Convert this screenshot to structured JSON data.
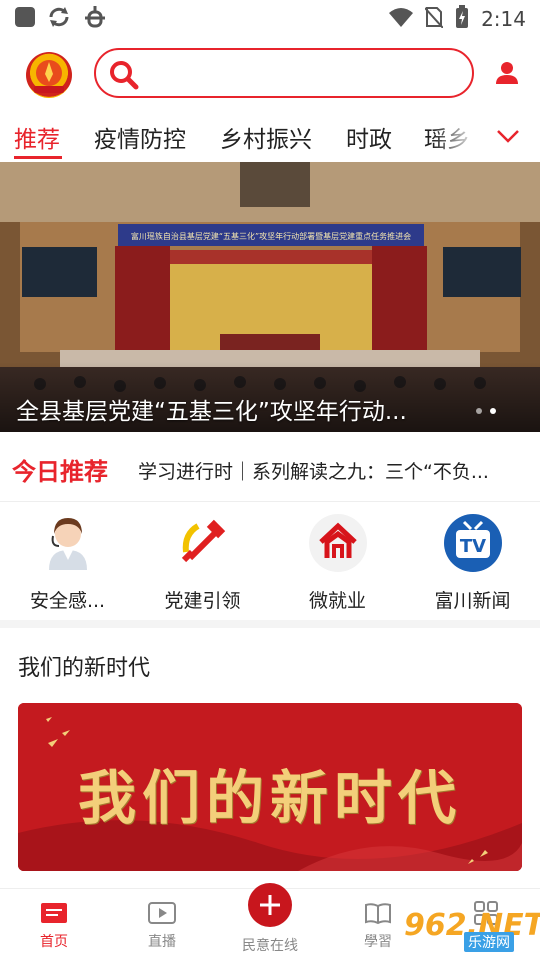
{
  "status_bar": {
    "time": "2:14",
    "icons": [
      "app-square-icon",
      "sync-icon",
      "bug-icon",
      "wifi-icon",
      "no-sim-icon",
      "battery-charging-icon"
    ]
  },
  "header": {
    "logo": "富川融媒",
    "search": {
      "placeholder": ""
    }
  },
  "tabs": [
    {
      "label": "推荐",
      "active": true
    },
    {
      "label": "疫情防控",
      "active": false
    },
    {
      "label": "乡村振兴",
      "active": false
    },
    {
      "label": "时政",
      "active": false
    },
    {
      "label": "瑶乡",
      "active": false
    }
  ],
  "banner": {
    "caption": "全县基层党建“五基三化”攻坚年行动...",
    "hall_banner_text": "富川瑶族自治县基层党建“五基三化”攻坚年行动部署暨基层党建重点任务推进会",
    "dots": [
      false,
      true
    ]
  },
  "today": {
    "title": "今日推荐",
    "text": "学习进行时｜系列解读之九：三个“不负..."
  },
  "quick_links": [
    {
      "label": "安全感...",
      "icon": "customer-service-icon"
    },
    {
      "label": "党建引领",
      "icon": "party-emblem-icon"
    },
    {
      "label": "微就业",
      "icon": "employment-icon"
    },
    {
      "label": "富川新闻",
      "icon": "tv-icon"
    }
  ],
  "section": {
    "title": "我们的新时代",
    "banner_text": "我们的新时代"
  },
  "bottom_nav": [
    {
      "label": "首页",
      "icon": "home-news-icon",
      "active": true
    },
    {
      "label": "直播",
      "icon": "play-icon",
      "active": false
    },
    {
      "label": "民意在线",
      "icon": "plus-icon",
      "active": false
    },
    {
      "label": "學習",
      "icon": "book-icon",
      "active": false
    },
    {
      "label": "",
      "icon": "apps-grid-icon",
      "active": false
    }
  ],
  "watermark": {
    "number": "962.NET",
    "site": "乐游网"
  },
  "colors": {
    "accent": "#e8242c",
    "gold": "#f3cf7a",
    "deep_red": "#c41a1f"
  }
}
